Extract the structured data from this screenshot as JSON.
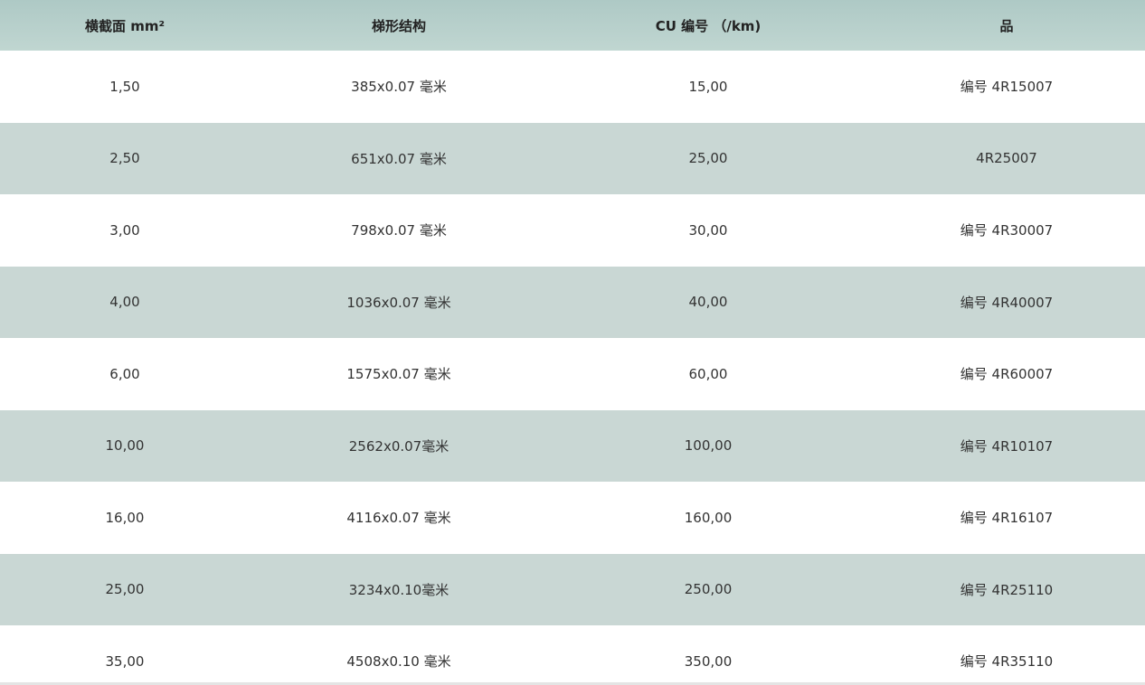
{
  "table": {
    "headers": [
      "横截面 mm²",
      "梯形结构",
      "CU 编号 （/km)",
      "品"
    ],
    "rows": [
      [
        "1,50",
        "385x0.07 毫米",
        "15,00",
        "编号 4R15007"
      ],
      [
        "2,50",
        "651x0.07 毫米",
        "25,00",
        "4R25007"
      ],
      [
        "3,00",
        "798x0.07 毫米",
        "30,00",
        "编号 4R30007"
      ],
      [
        "4,00",
        "1036x0.07 毫米",
        "40,00",
        "编号 4R40007"
      ],
      [
        "6,00",
        "1575x0.07 毫米",
        "60,00",
        "编号 4R60007"
      ],
      [
        "10,00",
        "2562x0.07毫米",
        "100,00",
        "编号 4R10107"
      ],
      [
        "16,00",
        "4116x0.07 毫米",
        "160,00",
        "编号 4R16107"
      ],
      [
        "25,00",
        "3234x0.10毫米",
        "250,00",
        "编号 4R25110"
      ],
      [
        "35,00",
        "4508x0.10 毫米",
        "350,00",
        "编号 4R35110"
      ]
    ]
  },
  "colors": {
    "header_bg": "#b7cfcb",
    "stripe_bg": "#c9d7d4",
    "text": "#333333"
  }
}
